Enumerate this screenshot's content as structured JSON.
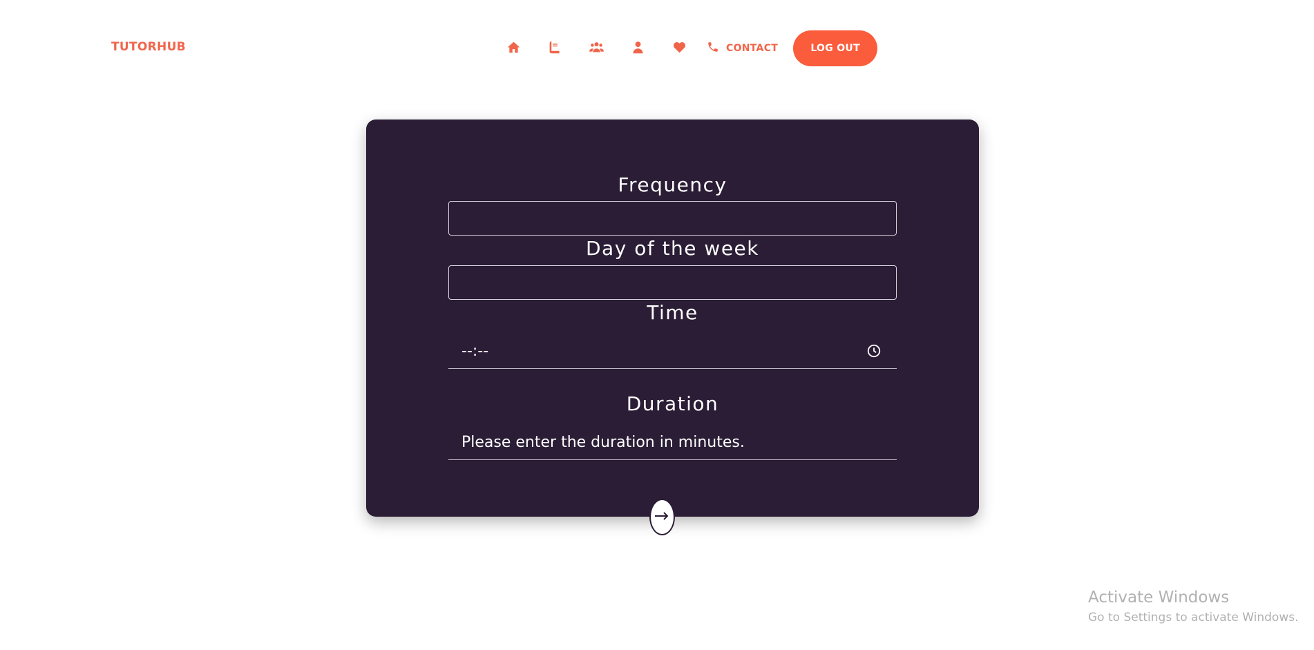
{
  "brand": "TUTORHUB",
  "nav": {
    "icons": [
      "home-icon",
      "book-icon",
      "users-icon",
      "user-icon",
      "heart-icon"
    ],
    "contact_label": "CONTACT",
    "logout_label": "LOG OUT"
  },
  "form": {
    "frequency_label": "Frequency",
    "frequency_value": "",
    "day_label": "Day of the week",
    "day_value": "",
    "time_label": "Time",
    "time_value": "--:--",
    "duration_label": "Duration",
    "duration_placeholder": "Please enter the duration in minutes."
  },
  "watermark": {
    "title": "Activate Windows",
    "subtitle": "Go to Settings to activate Windows."
  },
  "colors": {
    "accent": "#f0654a",
    "logout_bg": "#fa5c3c",
    "card_bg": "#2a1d35"
  }
}
